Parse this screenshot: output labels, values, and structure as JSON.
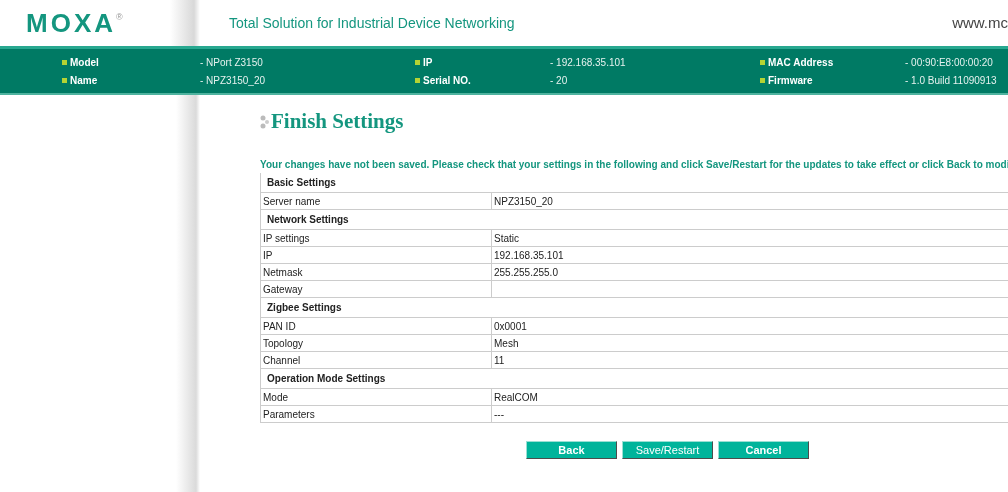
{
  "header": {
    "logo": "MOXA",
    "logo_mark": "®",
    "tagline": "Total Solution for Industrial Device Networking",
    "url": "www.mc"
  },
  "info": [
    {
      "label": "Model",
      "value": "- NPort Z3150"
    },
    {
      "label": "IP",
      "value": "- 192.168.35.101"
    },
    {
      "label": "MAC Address",
      "value": "- 00:90:E8:00:00:20"
    },
    {
      "label": "Name",
      "value": "- NPZ3150_20"
    },
    {
      "label": "Serial NO.",
      "value": "- 20"
    },
    {
      "label": "Firmware",
      "value": "- 1.0 Build 11090913"
    }
  ],
  "title": "Finish Settings",
  "notice": "Your changes have not been saved. Please check that your settings in the following and click Save/Restart for the updates to take effect or click Back to modi",
  "sections": [
    {
      "title": "Basic Settings",
      "rows": [
        {
          "label": "Server name",
          "value": "NPZ3150_20"
        }
      ]
    },
    {
      "title": "Network Settings",
      "rows": [
        {
          "label": "IP settings",
          "value": "Static"
        },
        {
          "label": "IP",
          "value": "192.168.35.101"
        },
        {
          "label": "Netmask",
          "value": "255.255.255.0"
        },
        {
          "label": "Gateway"
        }
      ]
    },
    {
      "title": "Zigbee Settings",
      "rows": [
        {
          "label": "PAN ID",
          "value": "0x0001"
        },
        {
          "label": "Topology",
          "value": "Mesh"
        },
        {
          "label": "Channel",
          "value": "11"
        }
      ]
    },
    {
      "title": "Operation Mode Settings",
      "rows": [
        {
          "label": "Mode",
          "value": "RealCOM"
        },
        {
          "label": "Parameters",
          "value": "---"
        }
      ]
    }
  ],
  "buttons": [
    "Back",
    "Save/Restart",
    "Cancel"
  ]
}
